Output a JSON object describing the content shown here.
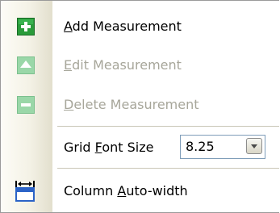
{
  "menu": {
    "items": [
      {
        "id": "add",
        "icon": "add-plus-icon",
        "prefix": "",
        "accel": "A",
        "suffix": "dd Measurement",
        "enabled": true
      },
      {
        "id": "edit",
        "icon": "edit-up-arrow-icon",
        "prefix": "",
        "accel": "E",
        "suffix": "dit Measurement",
        "enabled": false
      },
      {
        "id": "delete",
        "icon": "delete-minus-icon",
        "prefix": "",
        "accel": "D",
        "suffix": "elete Measurement",
        "enabled": false
      },
      {
        "id": "grid-font",
        "icon": "",
        "prefix": "Grid ",
        "accel": "F",
        "suffix": "ont Size",
        "enabled": true
      },
      {
        "id": "column-autowidth",
        "icon": "column-autowidth-icon",
        "prefix": "Column ",
        "accel": "A",
        "suffix": "uto-width",
        "enabled": true
      }
    ],
    "grid_font_size": {
      "value": "8.25",
      "dropdown_icon": "chevron-down-icon"
    }
  },
  "colors": {
    "enabled_icon_green": "#2a9b3a",
    "disabled_icon_green": "#9ad7a8",
    "disabled_text": "#a7a69a",
    "column_icon_blue": "#2b63c7"
  }
}
